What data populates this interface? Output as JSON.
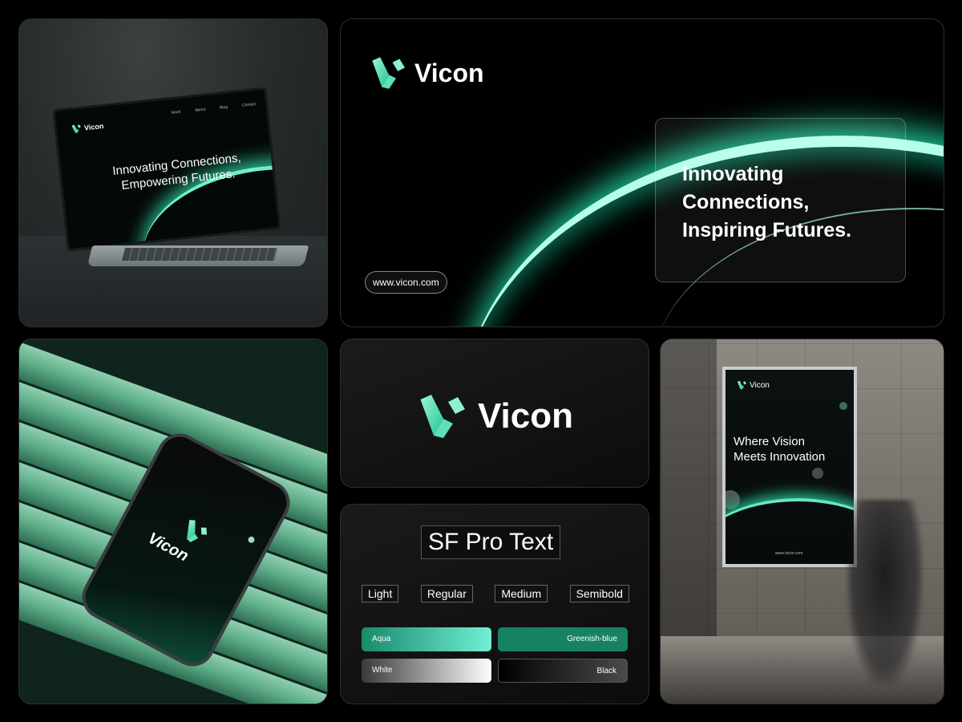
{
  "brand": {
    "name": "Vicon",
    "url": "www.vicon.com",
    "colors": {
      "aqua": "#72efd4",
      "greenish_blue": "#178263",
      "white": "#ffffff",
      "black": "#000000"
    }
  },
  "laptop": {
    "brand": "Vicon",
    "nav": [
      "Work",
      "About",
      "Blog",
      "Contact"
    ],
    "headline_line1": "Innovating Connections,",
    "headline_line2": "Empowering Futures."
  },
  "banner": {
    "brand": "Vicon",
    "headline_line1": "Innovating",
    "headline_line2": "Connections,",
    "headline_line3": "Inspiring Futures.",
    "url": "www.vicon.com"
  },
  "phone": {
    "brand": "Vicon"
  },
  "logo_panel": {
    "brand": "Vicon"
  },
  "typography": {
    "font_name": "SF Pro Text",
    "weights": [
      "Light",
      "Regular",
      "Medium",
      "Semibold"
    ],
    "swatches": [
      "Aqua",
      "Greenish-blue",
      "White",
      "Black"
    ]
  },
  "poster": {
    "brand": "Vicon",
    "headline_line1": "Where Vision",
    "headline_line2": "Meets Innovation",
    "url": "www.vicon.com"
  }
}
